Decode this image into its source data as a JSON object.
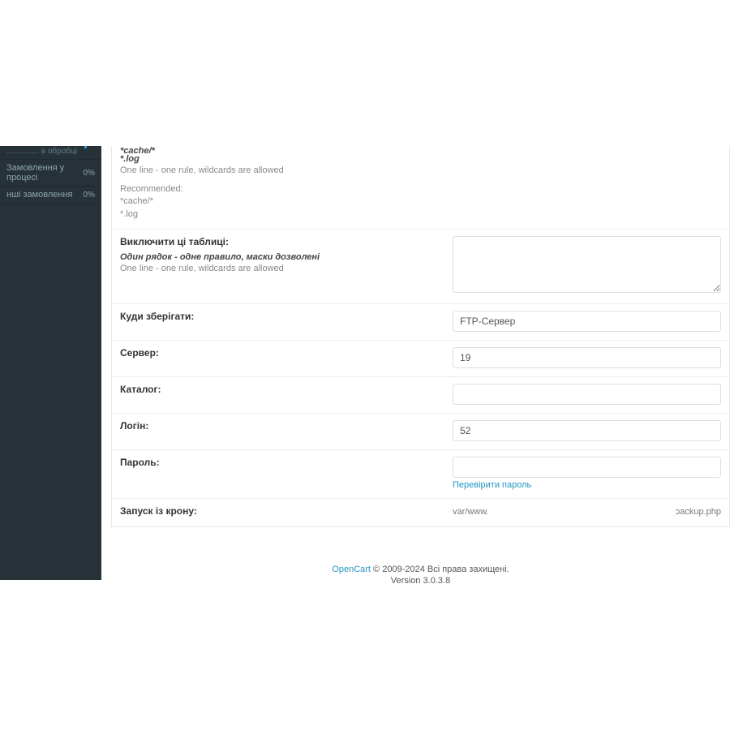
{
  "sidebar": {
    "header_partial": "………… в обробці",
    "items": [
      {
        "label": "Замовлення у процесі",
        "badge": "0%"
      },
      {
        "label": "нші замовлення",
        "badge": "0%"
      }
    ]
  },
  "form": {
    "exclude_files": {
      "example1": "*cache/*",
      "example2": "*.log",
      "help": "One line - one rule, wildcards are allowed",
      "rec_title": "Recommended:",
      "rec1": "*cache/*",
      "rec2": "*.log"
    },
    "exclude_tables": {
      "label": "Виключити ці таблиці:",
      "sub": "Один рядок - одне правило, маски дозволені",
      "help": "One line - one rule, wildcards are allowed",
      "value": ""
    },
    "storage": {
      "label": "Куди зберігати:",
      "value": "FTP-Сервер"
    },
    "server": {
      "label": "Сервер:",
      "value": "19"
    },
    "catalog": {
      "label": "Каталог:",
      "value": ""
    },
    "login": {
      "label": "Логін:",
      "value": "52"
    },
    "password": {
      "label": "Пароль:",
      "value": "",
      "check": "Перевірити пароль"
    },
    "cron": {
      "label": "Запуск із крону:",
      "left": "var/www.",
      "right": "ɔackup.php"
    }
  },
  "footer": {
    "brand": "OpenCart",
    "copy": " © 2009-2024 Всі права захищені.",
    "version": "Version 3.0.3.8"
  }
}
